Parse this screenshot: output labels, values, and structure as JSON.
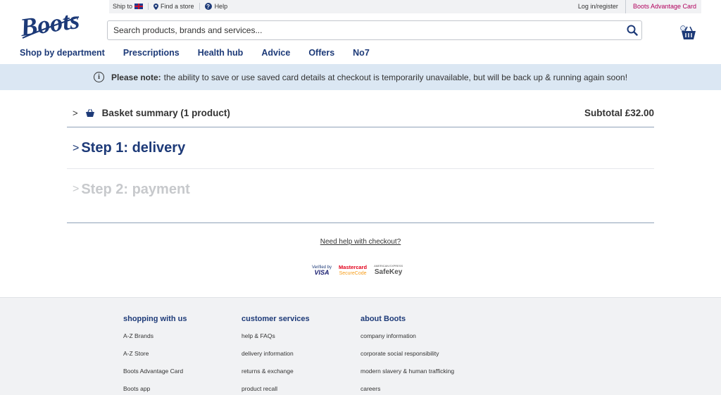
{
  "utility": {
    "ship_to": "Ship to",
    "find_store": "Find a store",
    "help": "Help",
    "login": "Log in/register",
    "advantage_card": "Boots Advantage Card"
  },
  "logo": {
    "alt": "Boots"
  },
  "search": {
    "placeholder": "Search products, brands and services..."
  },
  "nav": [
    "Shop by department",
    "Prescriptions",
    "Health hub",
    "Advice",
    "Offers",
    "No7"
  ],
  "notice": {
    "bold": "Please note:",
    "text": "the ability to save or use saved card details at checkout is temporarily unavailable, but will be back up & running again soon!"
  },
  "checkout": {
    "basket_label": "Basket summary (1 product)",
    "subtotal": "Subtotal £32.00",
    "step1": "Step 1: delivery",
    "step2": "Step 2: payment",
    "help_link": "Need help with checkout?"
  },
  "secure": {
    "visa_top": "Verified by",
    "visa": "VISA",
    "mc": "Mastercard",
    "mc_sub": "SecureCode",
    "amex_top": "AMERICAN EXPRESS",
    "amex": "SafeKey"
  },
  "footer": {
    "col1": {
      "title": "shopping with us",
      "links": [
        "A-Z Brands",
        "A-Z Store",
        "Boots Advantage Card",
        "Boots app"
      ]
    },
    "col2": {
      "title": "customer services",
      "links": [
        "help & FAQs",
        "delivery information",
        "returns & exchange",
        "product recall"
      ]
    },
    "col3": {
      "title": "about Boots",
      "links": [
        "company information",
        "corporate social responsibility",
        "modern slavery & human trafficking",
        "careers"
      ]
    }
  },
  "colors": {
    "brand_blue": "#1d3a78",
    "advantage_pink": "#b1005d",
    "notice_bg": "#dbe7f3"
  }
}
